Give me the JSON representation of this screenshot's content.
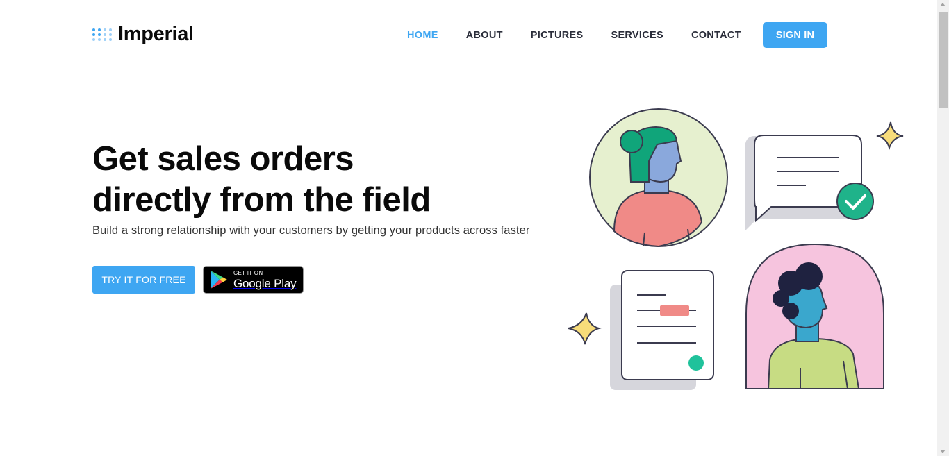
{
  "brand": {
    "name": "Imperial",
    "logo_icon": "dot-grid-icon",
    "accent_color": "#3ea6f2"
  },
  "nav": {
    "items": [
      {
        "label": "HOME",
        "active": true
      },
      {
        "label": "ABOUT",
        "active": false
      },
      {
        "label": "PICTURES",
        "active": false
      },
      {
        "label": "SERVICES",
        "active": false
      },
      {
        "label": "CONTACT",
        "active": false
      }
    ],
    "signin_label": "SIGN IN"
  },
  "hero": {
    "title_line1": "Get sales orders",
    "title_line2": "directly from the field",
    "subtitle": "Build a strong relationship with your customers by getting your products across faster",
    "cta_label": "TRY IT FOR FREE",
    "store_badge": {
      "small": "GET IT ON",
      "big": "Google Play",
      "icon": "google-play-icon"
    }
  },
  "illustration": {
    "icons": [
      "woman-avatar-icon",
      "chat-bubble-icon",
      "checkmark-icon",
      "document-icon",
      "man-avatar-icon",
      "sparkle-icon"
    ],
    "colors": {
      "green_bg": "#e6f0cf",
      "pink_bg": "#f6c4de",
      "check": "#1fb38a",
      "star": "#f7dc7a"
    }
  }
}
